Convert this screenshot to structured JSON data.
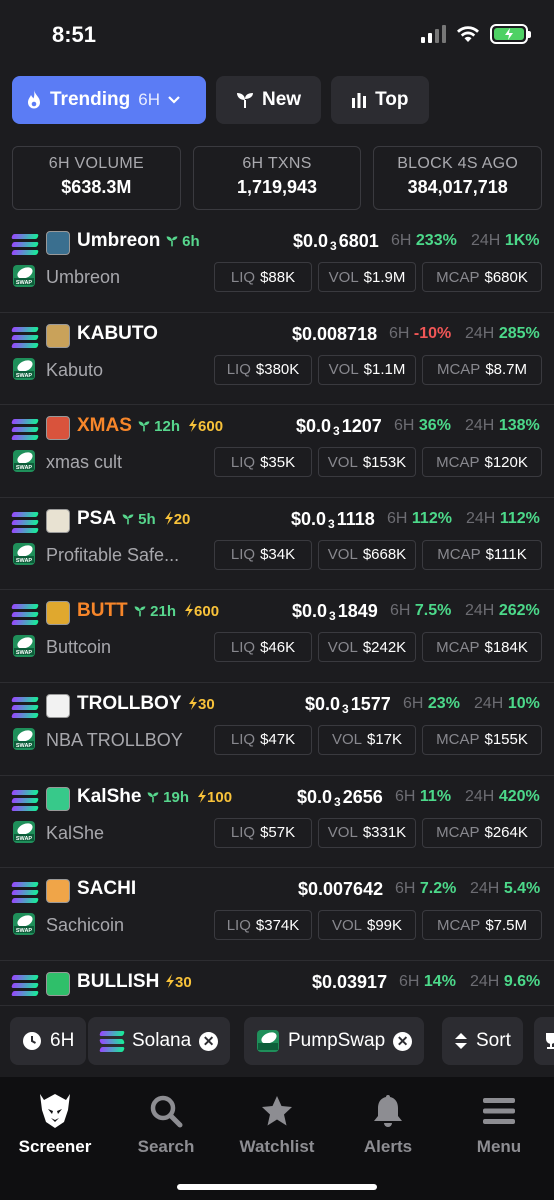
{
  "status": {
    "time": "8:51"
  },
  "top_tabs": [
    {
      "label": "Trending",
      "sub": "6H",
      "icon": "flame-icon",
      "active": true
    },
    {
      "label": "New",
      "icon": "sprout-icon",
      "active": false
    },
    {
      "label": "Top",
      "icon": "bar-chart-icon",
      "active": false
    }
  ],
  "stats": [
    {
      "label": "6H VOLUME",
      "value": "$638.3M"
    },
    {
      "label": "6H TXNS",
      "value": "1,719,943"
    },
    {
      "label": "BLOCK 4S AGO",
      "value": "384,017,718"
    }
  ],
  "metric_labels": {
    "liq": "LIQ",
    "vol": "VOL",
    "mcap": "MCAP",
    "h6": "6H",
    "h24": "24H"
  },
  "tokens": [
    {
      "symbol": "Umbreon",
      "symbol_color": "#ffffff",
      "age": "6h",
      "boost": "",
      "name": "Umbreon",
      "price_pre": "$0.0",
      "price_sub": "3",
      "price_post": "6801",
      "price_full": "",
      "chg6": "233%",
      "chg6_dir": "pos",
      "chg24": "1K%",
      "chg24_dir": "pos",
      "liq": "$88K",
      "vol": "$1.9M",
      "mcap": "$680K",
      "img_color": "#3a6f8f"
    },
    {
      "symbol": "KABUTO",
      "symbol_color": "#ffffff",
      "age": "",
      "boost": "",
      "name": "Kabuto",
      "price_pre": "",
      "price_sub": "",
      "price_post": "",
      "price_full": "$0.008718",
      "chg6": "-10%",
      "chg6_dir": "neg",
      "chg24": "285%",
      "chg24_dir": "pos",
      "liq": "$380K",
      "vol": "$1.1M",
      "mcap": "$8.7M",
      "img_color": "#c9a25a"
    },
    {
      "symbol": "XMAS",
      "symbol_color": "#f7862a",
      "age": "12h",
      "boost": "600",
      "name": "xmas cult",
      "price_pre": "$0.0",
      "price_sub": "3",
      "price_post": "1207",
      "price_full": "",
      "chg6": "36%",
      "chg6_dir": "pos",
      "chg24": "138%",
      "chg24_dir": "pos",
      "liq": "$35K",
      "vol": "$153K",
      "mcap": "$120K",
      "img_color": "#d9533c"
    },
    {
      "symbol": "PSA",
      "symbol_color": "#ffffff",
      "age": "5h",
      "boost": "20",
      "name": "Profitable Safe...",
      "price_pre": "$0.0",
      "price_sub": "3",
      "price_post": "1118",
      "price_full": "",
      "chg6": "112%",
      "chg6_dir": "pos",
      "chg24": "112%",
      "chg24_dir": "pos",
      "liq": "$34K",
      "vol": "$668K",
      "mcap": "$111K",
      "img_color": "#e8e2d2"
    },
    {
      "symbol": "BUTT",
      "symbol_color": "#f7862a",
      "age": "21h",
      "boost": "600",
      "name": "Buttcoin",
      "price_pre": "$0.0",
      "price_sub": "3",
      "price_post": "1849",
      "price_full": "",
      "chg6": "7.5%",
      "chg6_dir": "pos",
      "chg24": "262%",
      "chg24_dir": "pos",
      "liq": "$46K",
      "vol": "$242K",
      "mcap": "$184K",
      "img_color": "#e0a82e"
    },
    {
      "symbol": "TROLLBOY",
      "symbol_color": "#ffffff",
      "age": "",
      "boost": "30",
      "name": "NBA TROLLBOY",
      "price_pre": "$0.0",
      "price_sub": "3",
      "price_post": "1577",
      "price_full": "",
      "chg6": "23%",
      "chg6_dir": "pos",
      "chg24": "10%",
      "chg24_dir": "pos",
      "liq": "$47K",
      "vol": "$17K",
      "mcap": "$155K",
      "img_color": "#f2f2f2"
    },
    {
      "symbol": "KalShe",
      "symbol_color": "#ffffff",
      "age": "19h",
      "boost": "100",
      "name": "KalShe",
      "price_pre": "$0.0",
      "price_sub": "3",
      "price_post": "2656",
      "price_full": "",
      "chg6": "11%",
      "chg6_dir": "pos",
      "chg24": "420%",
      "chg24_dir": "pos",
      "liq": "$57K",
      "vol": "$331K",
      "mcap": "$264K",
      "img_color": "#37c98a"
    },
    {
      "symbol": "SACHI",
      "symbol_color": "#ffffff",
      "age": "",
      "boost": "",
      "name": "Sachicoin",
      "price_pre": "",
      "price_sub": "",
      "price_post": "",
      "price_full": "$0.007642",
      "chg6": "7.2%",
      "chg6_dir": "pos",
      "chg24": "5.4%",
      "chg24_dir": "pos",
      "liq": "$374K",
      "vol": "$99K",
      "mcap": "$7.5M",
      "img_color": "#f0a548"
    },
    {
      "symbol": "BULLISH",
      "symbol_color": "#ffffff",
      "age": "",
      "boost": "30",
      "name": "",
      "price_pre": "",
      "price_sub": "",
      "price_post": "",
      "price_full": "$0.03917",
      "chg6": "14%",
      "chg6_dir": "pos",
      "chg24": "9.6%",
      "chg24_dir": "pos",
      "liq": "",
      "vol": "",
      "mcap": "",
      "img_color": "#2fbf6a"
    }
  ],
  "filters": [
    {
      "label": "6H",
      "icon": "clock-icon"
    },
    {
      "label": "Solana",
      "icon": "solana-icon",
      "removable": true
    },
    {
      "label": "PumpSwap",
      "icon": "pumpswap-icon",
      "removable": true
    },
    {
      "label": "Sort",
      "icon": "sort-icon"
    }
  ],
  "nav": [
    {
      "label": "Screener",
      "icon": "screener-logo-icon",
      "active": true
    },
    {
      "label": "Search",
      "icon": "search-icon",
      "active": false
    },
    {
      "label": "Watchlist",
      "icon": "star-icon",
      "active": false
    },
    {
      "label": "Alerts",
      "icon": "bell-icon",
      "active": false
    },
    {
      "label": "Menu",
      "icon": "menu-icon",
      "active": false
    }
  ]
}
